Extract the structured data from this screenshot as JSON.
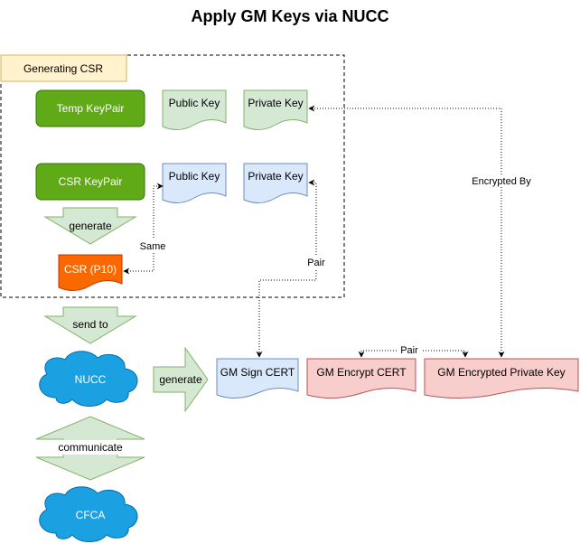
{
  "title": "Apply GM Keys via NUCC",
  "colors": {
    "green_fill": "#60a917",
    "green_stroke": "#2d7600",
    "pale_green_fill": "#d5e8d4",
    "pale_green_stroke": "#82b366",
    "blue_fill": "#dae8fc",
    "blue_stroke": "#6c8ebf",
    "red_fill": "#f8cecc",
    "red_stroke": "#b85450",
    "orange_fill": "#fa6800",
    "orange_stroke": "#c73500",
    "cloud_fill": "#1ba1e2",
    "cloud_stroke": "#006eaf",
    "note_fill": "#fff2cc",
    "note_stroke": "#d6b656"
  },
  "group": {
    "label": "Generating CSR"
  },
  "nodes": {
    "temp_keypair": "Temp KeyPair",
    "temp_public_key": "Public Key",
    "temp_private_key": "Private Key",
    "csr_keypair": "CSR KeyPair",
    "csr_public_key": "Public Key",
    "csr_private_key": "Private Key",
    "csr_p10": "CSR (P10)",
    "nucc": "NUCC",
    "cfca": "CFCA",
    "gm_sign_cert": "GM Sign CERT",
    "gm_encrypt_cert": "GM Encrypt CERT",
    "gm_encrypted_private_key": "GM Encrypted Private Key"
  },
  "arrows": {
    "generate_csr": "generate",
    "send_to": "send to",
    "generate_certs": "generate",
    "communicate": "communicate"
  },
  "edges": {
    "same": "Same",
    "pair_sign": "Pair",
    "pair_encrypt": "Pair",
    "encrypted_by": "Encrypted By"
  }
}
